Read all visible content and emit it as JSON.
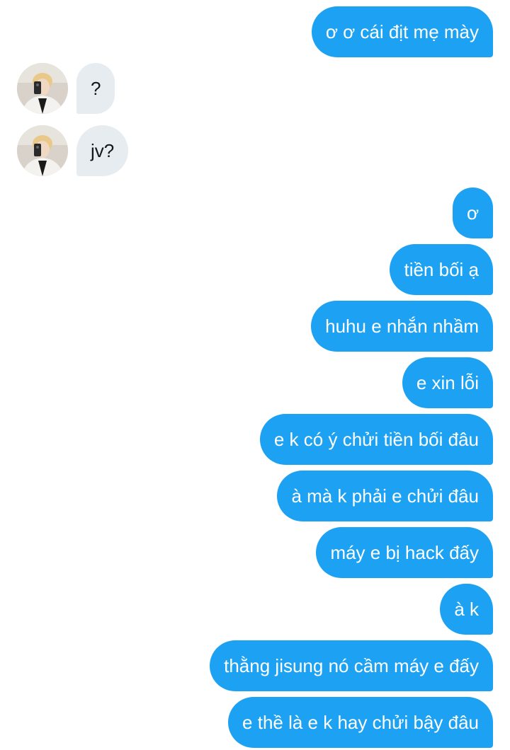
{
  "messages": [
    {
      "dir": "out",
      "text": "ơ ơ cái địt mẹ mày"
    },
    {
      "dir": "in",
      "text": "?",
      "avatar": "profile-photo"
    },
    {
      "dir": "in",
      "text": "jv?",
      "avatar": "profile-photo"
    },
    {
      "dir": "out",
      "text": "ơ"
    },
    {
      "dir": "out",
      "text": "tiền bối ạ"
    },
    {
      "dir": "out",
      "text": "huhu e nhắn nhầm"
    },
    {
      "dir": "out",
      "text": "e xin lỗi"
    },
    {
      "dir": "out",
      "text": "e k có ý chửi tiền bối đâu"
    },
    {
      "dir": "out",
      "text": "à mà k phải e chửi đâu"
    },
    {
      "dir": "out",
      "text": "máy e bị hack đấy"
    },
    {
      "dir": "out",
      "text": "à k"
    },
    {
      "dir": "out",
      "text": "thằng jisung nó cầm máy e đấy"
    },
    {
      "dir": "out",
      "text": "e thề là e k hay chửi bậy đâu"
    }
  ],
  "colors": {
    "outgoing_bubble": "#1da1f2",
    "incoming_bubble": "#e6ecf0"
  }
}
